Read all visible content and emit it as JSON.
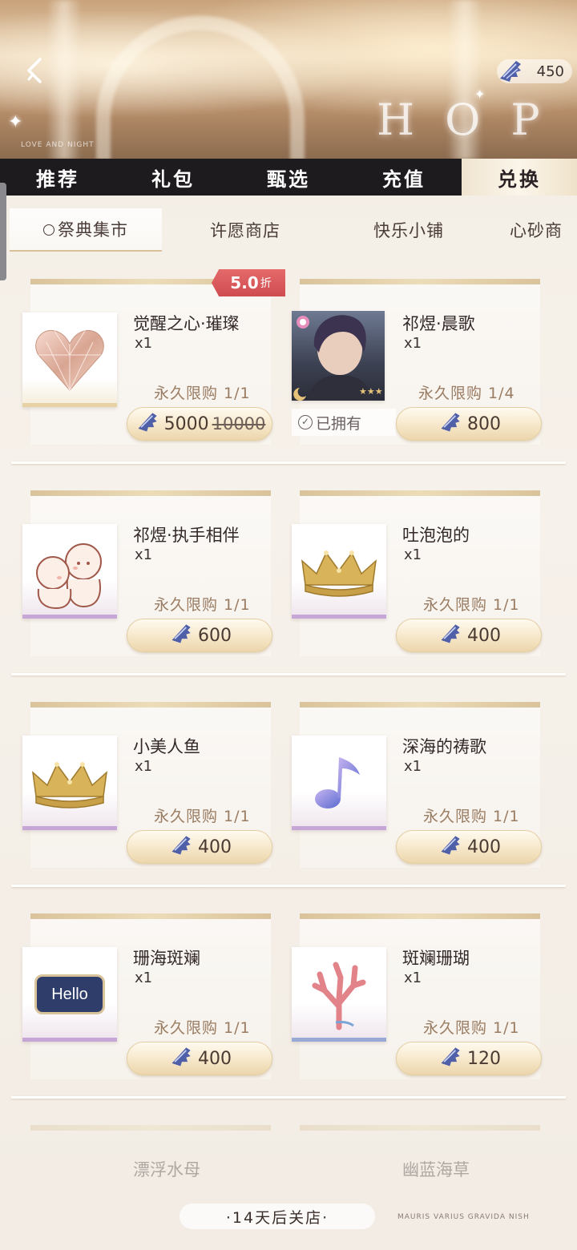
{
  "header": {
    "back_icon": "chevron-left-icon",
    "currency": {
      "icon": "shell-icon",
      "amount": "450"
    },
    "shop_word": "HOP",
    "deco_text": "LOVE AND NIGHT"
  },
  "main_tabs": [
    {
      "label": "推荐",
      "active": false
    },
    {
      "label": "礼包",
      "active": false
    },
    {
      "label": "甄选",
      "active": false
    },
    {
      "label": "充值",
      "active": false
    },
    {
      "label": "兑换",
      "active": true
    }
  ],
  "sub_tabs": [
    {
      "label": "祭典集市",
      "active": true,
      "icon": "clock-icon"
    },
    {
      "label": "许愿商店",
      "active": false
    },
    {
      "label": "快乐小铺",
      "active": false
    },
    {
      "label": "心砂商",
      "active": false
    }
  ],
  "discount_badge": {
    "value": "5.0",
    "unit": "折"
  },
  "items": [
    {
      "name": "觉醒之心·璀璨",
      "qty": "x1",
      "limit": "永久限购 1/1",
      "price": "5000",
      "old_price": "10000",
      "thumb": "diamond-heart-icon"
    },
    {
      "name": "祁煜·晨歌",
      "qty": "x1",
      "limit": "永久限购 1/4",
      "price": "800",
      "owned_label": "已拥有",
      "thumb": "character-portrait"
    },
    {
      "name": "祁煜·执手相伴",
      "qty": "x1",
      "limit": "永久限购 1/1",
      "price": "600",
      "thumb": "chibi-couple-icon"
    },
    {
      "name": "吐泡泡的",
      "qty": "x1",
      "limit": "永久限购 1/1",
      "price": "400",
      "thumb": "golden-crown-icon"
    },
    {
      "name": "小美人鱼",
      "qty": "x1",
      "limit": "永久限购 1/1",
      "price": "400",
      "thumb": "golden-crown-icon"
    },
    {
      "name": "深海的祷歌",
      "qty": "x1",
      "limit": "永久限购 1/1",
      "price": "400",
      "thumb": "music-note-icon"
    },
    {
      "name": "珊海斑斓",
      "qty": "x1",
      "limit": "永久限购 1/1",
      "price": "400",
      "thumb": "hello-frame-icon",
      "thumb_text": "Hello"
    },
    {
      "name": "斑斓珊瑚",
      "qty": "x1",
      "limit": "永久限购 1/1",
      "price": "120",
      "thumb": "coral-icon"
    },
    {
      "name": "漂浮水母",
      "thumb": "jellyfish-icon"
    },
    {
      "name": "幽蓝海草",
      "thumb": "seaweed-icon"
    }
  ],
  "footer": {
    "close_notice": "·14天后关店·",
    "deco_text": "MAURIS VARIUS GRAVIDA NISH"
  },
  "colors": {
    "tab_bar": "#1e1b1e",
    "active_tab": "#f4ead8",
    "limit_text": "#9a7c62",
    "discount_red": "#d9575b",
    "card_gold": "#d9c39b"
  }
}
